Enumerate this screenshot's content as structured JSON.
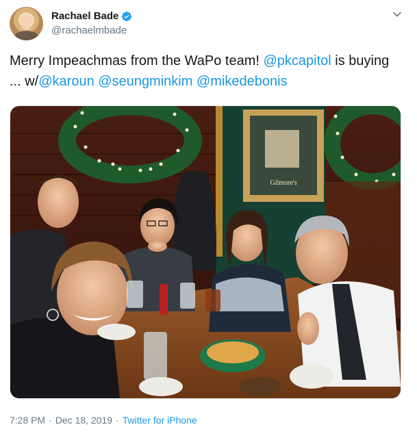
{
  "author": {
    "display_name": "Rachael Bade",
    "handle": "@rachaelmbade"
  },
  "tweet": {
    "text_lead": "Merry Impeachmas from the WaPo team! ",
    "mention1": "@pkcapitol",
    "text_mid1": " is buying ... w/",
    "mention2": "@karoun",
    "space1": " ",
    "mention3": "@seungminkim",
    "space2": " ",
    "mention4": "@mikedebonis"
  },
  "photo": {
    "sign_text": "Gilmore's"
  },
  "meta": {
    "time": "7:28 PM",
    "dot": "·",
    "date": "Dec 18, 2019",
    "dot2": "·",
    "source": "Twitter for iPhone"
  },
  "colors": {
    "link": "#1b95e0",
    "secondary_text": "#657786",
    "verified": "#1da1f2"
  }
}
